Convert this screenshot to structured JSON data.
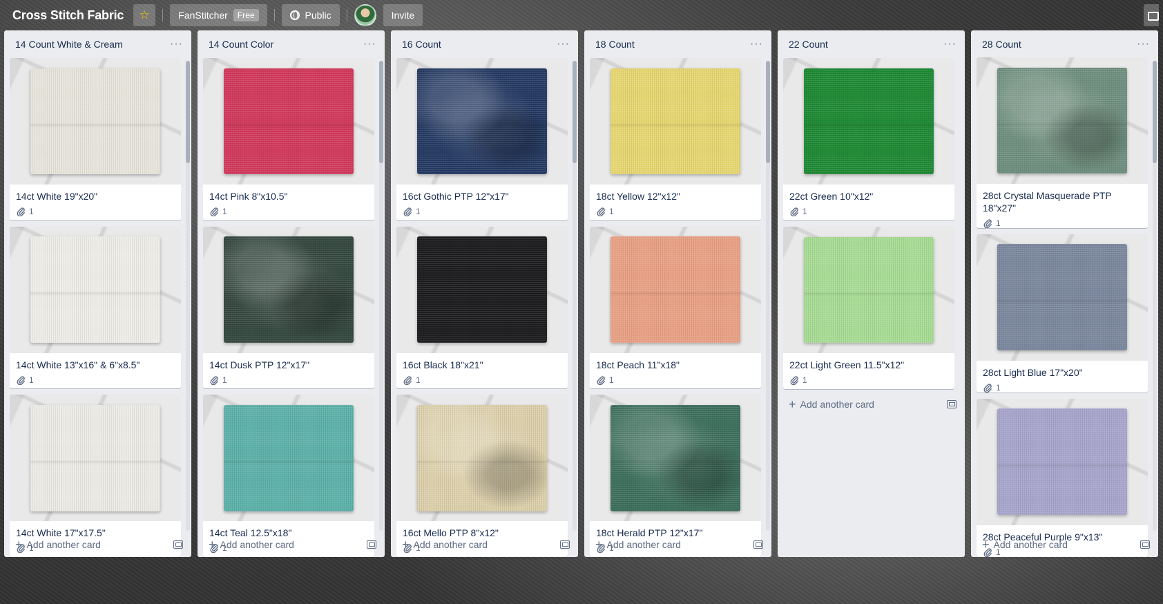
{
  "header": {
    "title": "Cross Stitch Fabric",
    "team": "FanStitcher",
    "team_badge": "Free",
    "visibility": "Public",
    "invite": "Invite"
  },
  "lists": [
    {
      "title": "14 Count White & Cream",
      "add_label": "Add another card",
      "cards": [
        {
          "title": "14ct White 19\"x20\"",
          "attachments": "1",
          "color": "#e7e5dc",
          "mottled": false
        },
        {
          "title": "14ct White 13\"x16\" & 6\"x8.5\"",
          "attachments": "1",
          "color": "#eeede7",
          "mottled": false
        },
        {
          "title": "14ct White 17\"x17.5\"",
          "attachments": "1",
          "color": "#ecebe4",
          "mottled": false
        }
      ]
    },
    {
      "title": "14 Count Color",
      "add_label": "Add another card",
      "cards": [
        {
          "title": "14ct Pink 8\"x10.5\"",
          "attachments": "1",
          "color": "#d23a5c",
          "mottled": false
        },
        {
          "title": "14ct Dusk PTP 12\"x17\"",
          "attachments": "1",
          "color": "#354840",
          "mottled": true
        },
        {
          "title": "14ct Teal 12.5\"x18\"",
          "attachments": "1",
          "color": "#5db2a9",
          "mottled": false
        }
      ]
    },
    {
      "title": "16 Count",
      "add_label": "Add another card",
      "cards": [
        {
          "title": "16ct Gothic PTP 12\"x17\"",
          "attachments": "1",
          "color": "#253a63",
          "mottled": true
        },
        {
          "title": "16ct Black 18\"x21\"",
          "attachments": "1",
          "color": "#1d1d1f",
          "mottled": false
        },
        {
          "title": "16ct Mello PTP 8\"x12\"",
          "attachments": "1",
          "color": "#ddd0ab",
          "mottled": true
        }
      ]
    },
    {
      "title": "18 Count",
      "add_label": "Add another card",
      "cards": [
        {
          "title": "18ct Yellow 12\"x12\"",
          "attachments": "1",
          "color": "#e6d772",
          "mottled": false
        },
        {
          "title": "18ct Peach 11\"x18\"",
          "attachments": "1",
          "color": "#e9a184",
          "mottled": false
        },
        {
          "title": "18ct Herald PTP 12\"x17\"",
          "attachments": "1",
          "color": "#3d6f5c",
          "mottled": true
        }
      ]
    },
    {
      "title": "22 Count",
      "add_label": "Add another card",
      "cards": [
        {
          "title": "22ct Green 10\"x12\"",
          "attachments": "1",
          "color": "#1f8a35",
          "mottled": false
        },
        {
          "title": "22ct Light Green 11.5\"x12\"",
          "attachments": "1",
          "color": "#a8dd95",
          "mottled": false
        }
      ]
    },
    {
      "title": "28 Count",
      "add_label": "Add another card",
      "cards": [
        {
          "title": "28ct Crystal Masquerade PTP 18\"x27\"",
          "attachments": "1",
          "color": "#6f8f7e",
          "mottled": true
        },
        {
          "title": "28ct Light Blue 17\"x20\"",
          "attachments": "1",
          "color": "#7c889e",
          "mottled": false
        },
        {
          "title": "28ct Peaceful Purple 9\"x13\"",
          "attachments": "1",
          "color": "#a8a6cc",
          "mottled": false
        }
      ]
    }
  ]
}
